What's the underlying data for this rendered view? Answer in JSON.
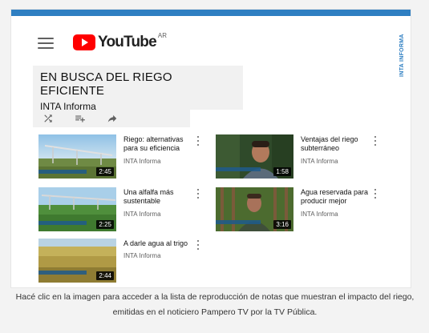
{
  "side_label": "INTA INFORMA",
  "header": {
    "logo_word": "YouTube",
    "region": "AR"
  },
  "playlist": {
    "title": "EN BUSCA DEL RIEGO EFICIENTE",
    "channel": "INTA Informa"
  },
  "actions": {
    "shuffle_icon": "shuffle-icon",
    "add_icon": "playlist-add-icon",
    "share_icon": "share-icon"
  },
  "videos": [
    {
      "title": "Riego: alternativas para su eficiencia",
      "channel": "INTA Informa",
      "duration": "2:45"
    },
    {
      "title": "Ventajas del riego subterráneo",
      "channel": "INTA Informa",
      "duration": "1:58"
    },
    {
      "title": "Una alfalfa más sustentable",
      "channel": "INTA Informa",
      "duration": "2:25"
    },
    {
      "title": "Agua reservada para producir mejor",
      "channel": "INTA Informa",
      "duration": "3:16"
    },
    {
      "title": "A darle agua al trigo",
      "channel": "INTA Informa",
      "duration": "2:44"
    }
  ],
  "caption": "Hacé clic en la imagen para acceder a la lista de reproducción de notas que muestran el impacto del riego, emitidas en el noticiero Pampero TV por la TV Pública.",
  "colors": {
    "accent": "#2f7fc2",
    "youtube_red": "#ff0000"
  }
}
